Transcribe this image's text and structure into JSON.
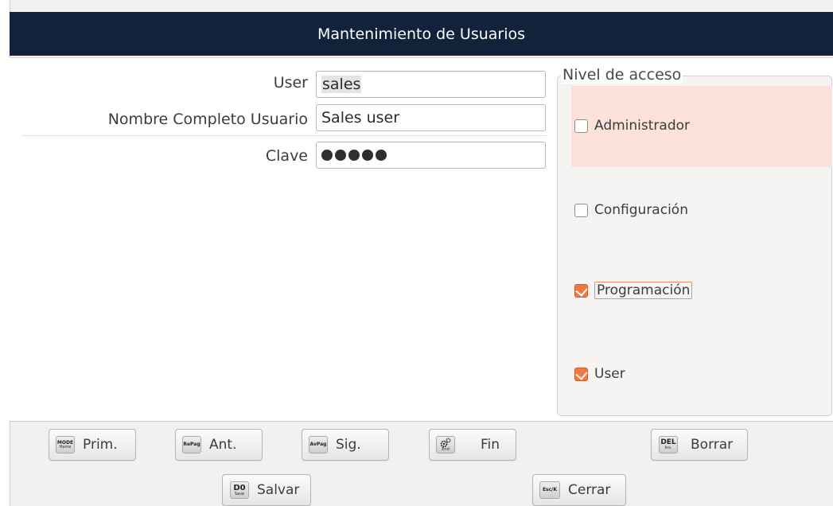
{
  "window": {
    "title": "Mantenimiento de Usuarios"
  },
  "form": {
    "user_label": "User",
    "user_value": "sales",
    "fullname_label": "Nombre Completo Usuario",
    "fullname_value": "Sales user",
    "password_label": "Clave",
    "password_masked_length": 5
  },
  "access": {
    "legend": "Nivel de acceso",
    "levels": [
      {
        "label": "Administrador",
        "checked": false
      },
      {
        "label": "Configuración",
        "checked": false
      },
      {
        "label": "Programación",
        "checked": true
      },
      {
        "label": "User",
        "checked": true
      }
    ]
  },
  "toolbar": {
    "first": {
      "key": "MODE",
      "key_sub": "Home",
      "label": "Prim."
    },
    "prev": {
      "key": "RePag",
      "label": "Ant."
    },
    "next": {
      "key": "AvPag",
      "label": "Sig."
    },
    "end": {
      "icon": "gears-icon",
      "key_sub": "End",
      "label": "Fin"
    },
    "delete": {
      "key": "DEL",
      "key_sub": "Ins.",
      "label": "Borrar"
    },
    "save": {
      "key": "D0",
      "key_sub": "Save",
      "label": "Salvar"
    },
    "close": {
      "key": "Esc/K",
      "label": "Cerrar"
    }
  },
  "colors": {
    "titlebar": "#12223a",
    "accent": "#f07746",
    "highlight": "#fce2da"
  }
}
